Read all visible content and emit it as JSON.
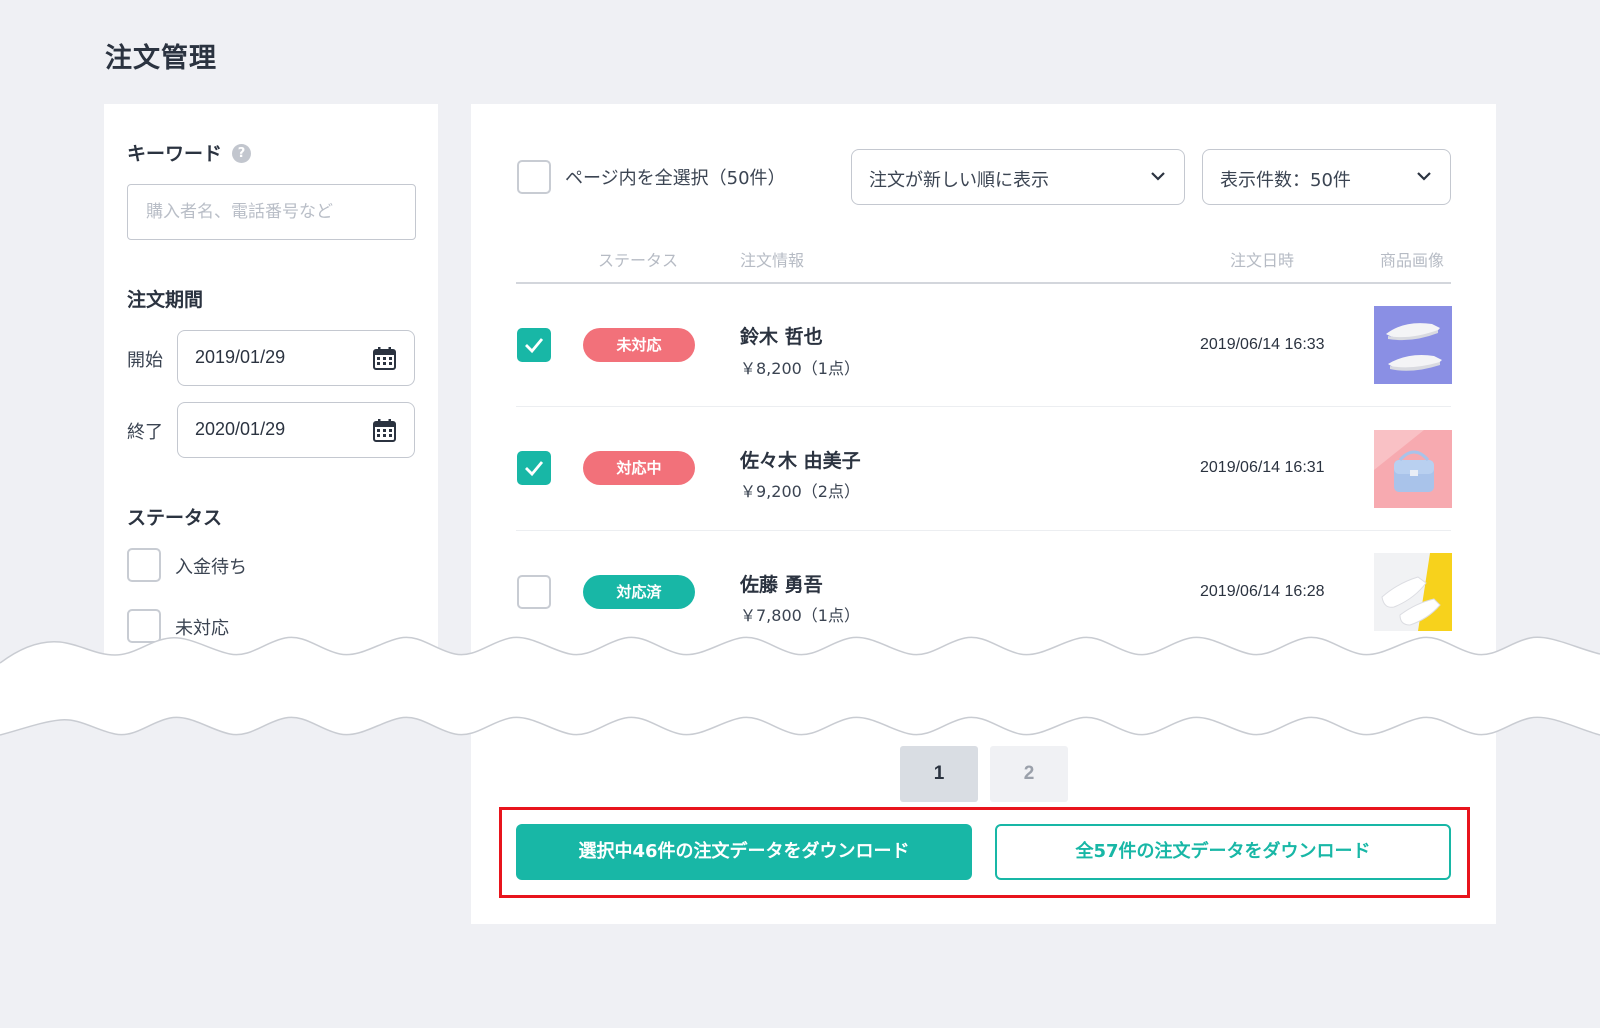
{
  "page": {
    "title": "注文管理"
  },
  "sidebar": {
    "keyword": {
      "label": "キーワード",
      "help": "?",
      "placeholder": "購入者名、電話番号など",
      "value": ""
    },
    "period": {
      "label": "注文期間",
      "start_label": "開始",
      "start_value": "2019/01/29",
      "end_label": "終了",
      "end_value": "2020/01/29"
    },
    "status": {
      "label": "ステータス",
      "options": [
        {
          "label": "入金待ち",
          "checked": false
        },
        {
          "label": "未対応",
          "checked": false
        }
      ]
    }
  },
  "toolbar": {
    "select_all_label": "ページ内を全選択（50件）",
    "sort_value": "注文が新しい順に表示",
    "per_page_value": "表示件数：50件"
  },
  "table": {
    "columns": {
      "status": "ステータス",
      "info": "注文情報",
      "date": "注文日時",
      "image": "商品画像"
    },
    "rows": [
      {
        "checked": true,
        "status": "未対応",
        "status_color": "#f2717a",
        "name": "鈴木 哲也",
        "price": "￥8,200（1点）",
        "date": "2019/06/14 16:33",
        "image": "sneakers-on-purple"
      },
      {
        "checked": true,
        "status": "対応中",
        "status_color": "#f2717a",
        "name": "佐々木 由美子",
        "price": "￥9,200（2点）",
        "date": "2019/06/14 16:31",
        "image": "blue-bag-on-pink"
      },
      {
        "checked": false,
        "status": "対応済",
        "status_color": "#18b7a6",
        "name": "佐藤 勇吾",
        "price": "￥7,800（1点）",
        "date": "2019/06/14 16:28",
        "image": "white-sneakers-on-yellow"
      }
    ]
  },
  "pagination": {
    "pages": [
      "1",
      "2"
    ],
    "current": "1"
  },
  "actions": {
    "download_selected": "選択中46件の注文データをダウンロード",
    "download_all": "全57件の注文データをダウンロード"
  },
  "colors": {
    "accent": "#18b7a6",
    "alert": "#f2717a",
    "highlight": "#e8141c",
    "background": "#eff0f4"
  }
}
